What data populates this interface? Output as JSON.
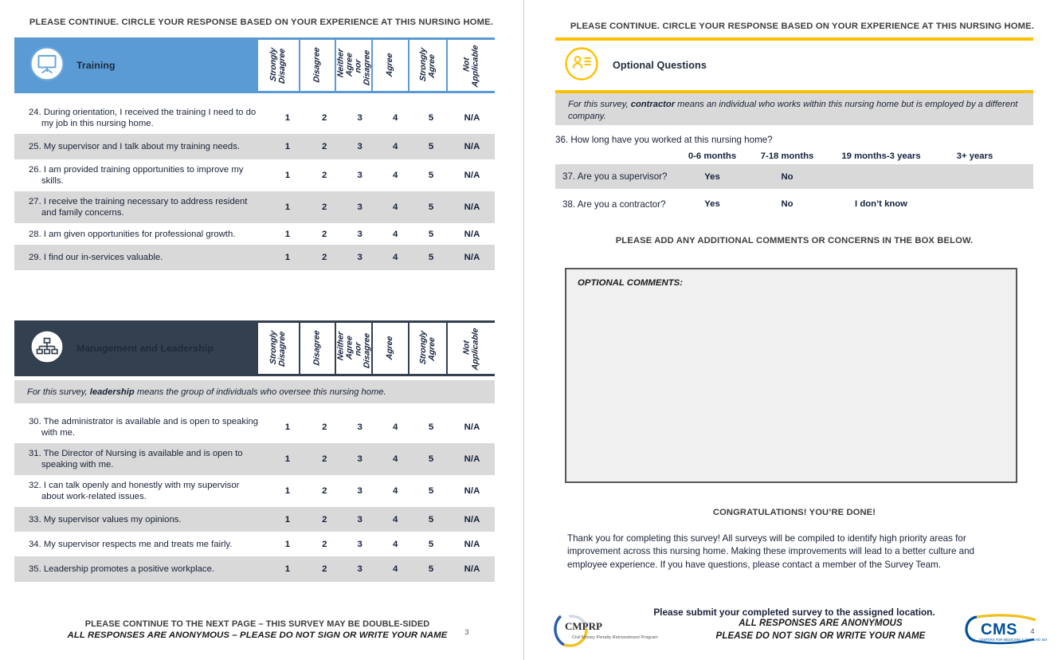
{
  "colors": {
    "training_blue": "#5b9bd5",
    "management_navy": "#33404f",
    "optional_yellow": "#ffc000",
    "row_shade": "#d9d9d9",
    "cms_blue": "#00529b",
    "cms_yellow": "#f2c01e"
  },
  "scale_labels": [
    "Strongly\nDisagree",
    "Disagree",
    "Neither\nAgree nor\nDisagree",
    "Agree",
    "Strongly\nAgree",
    "Not\nApplicable"
  ],
  "scale_values": [
    "1",
    "2",
    "3",
    "4",
    "5",
    "N/A"
  ],
  "left_page": {
    "banner": "PLEASE CONTINUE. CIRCLE YOUR RESPONSE BASED ON YOUR EXPERIENCE AT THIS NURSING HOME.",
    "sections": [
      {
        "title": "Training",
        "icon": "whiteboard-icon",
        "accent": "#5b9bd5",
        "note": null,
        "questions": [
          {
            "num": "24.",
            "text": "During orientation, I received the training I need to do my job in this nursing home.",
            "shaded": false
          },
          {
            "num": "25.",
            "text": "My supervisor and I talk about my training needs.",
            "shaded": true
          },
          {
            "num": "26.",
            "text": "I am provided training opportunities to improve my skills.",
            "shaded": false
          },
          {
            "num": "27.",
            "text": "I receive the training necessary to address resident and family concerns.",
            "shaded": true
          },
          {
            "num": "28.",
            "text": "I am given opportunities for professional growth.",
            "shaded": false
          },
          {
            "num": "29.",
            "text": "I find our in-services valuable.",
            "shaded": true
          }
        ]
      },
      {
        "title": "Management and Leadership",
        "icon": "org-chart-icon",
        "accent": "#33404f",
        "note_prefix": "For this survey, ",
        "note_bold": "leadership",
        "note_suffix": " means the group of individuals who oversee this nursing home.",
        "questions": [
          {
            "num": "30.",
            "text": "The administrator is available and is open to speaking with me.",
            "shaded": false
          },
          {
            "num": "31.",
            "text": "The Director of Nursing is available and is open to speaking with me.",
            "shaded": true
          },
          {
            "num": "32.",
            "text": "I can talk openly and honestly with my supervisor about work-related issues.",
            "shaded": false
          },
          {
            "num": "33.",
            "text": "My supervisor values my opinions.",
            "shaded": true
          },
          {
            "num": "34.",
            "text": "My supervisor respects me and treats me fairly.",
            "shaded": false
          },
          {
            "num": "35.",
            "text": "Leadership promotes a positive workplace.",
            "shaded": true
          }
        ]
      }
    ],
    "footer": {
      "line1": "PLEASE CONTINUE TO THE NEXT PAGE – THIS SURVEY MAY BE DOUBLE-SIDED",
      "line2": "ALL RESPONSES ARE ANONYMOUS – PLEASE DO NOT SIGN OR WRITE YOUR NAME",
      "page_number": "3"
    }
  },
  "right_page": {
    "banner": "PLEASE CONTINUE. CIRCLE YOUR RESPONSE BASED ON YOUR EXPERIENCE AT THIS NURSING HOME.",
    "section": {
      "title": "Optional Questions",
      "icon": "person-list-icon",
      "accent": "#ffc000",
      "note_prefix": "For this survey, ",
      "note_bold": "contractor",
      "note_suffix": " means an individual who works within this nursing home but is employed by a different company."
    },
    "questions": [
      {
        "num": "36.",
        "text": "How long have you worked at this nursing home?",
        "shaded": false,
        "choices": [
          "0-6 months",
          "7-18 months",
          "19 months-3 years",
          "3+ years"
        ],
        "choices_below": true
      },
      {
        "num": "37.",
        "text": "Are you a supervisor?",
        "shaded": true,
        "choices": [
          "Yes",
          "No"
        ],
        "choices_below": false
      },
      {
        "num": "38.",
        "text": "Are you a contractor?",
        "shaded": false,
        "choices": [
          "Yes",
          "No",
          "I don’t know"
        ],
        "choices_below": false
      }
    ],
    "comments_heading": "PLEASE ADD ANY ADDITIONAL COMMENTS OR CONCERNS IN THE BOX BELOW.",
    "comments_label": "OPTIONAL COMMENTS:",
    "comments_value": "",
    "congratulations": "CONGRATULATIONS! YOU’RE DONE!",
    "thank_you": "Thank you for completing this survey! All surveys will be compiled to identify high priority areas for improvement across this nursing home. Making these improvements will lead to a better culture and employee experience. If you have questions, please contact a member of the Survey Team.",
    "submit_line": "Please submit your completed survey to the assigned location.",
    "footer": {
      "cmprp_logo_text": "CMPRP",
      "cmprp_logo_sub": "Civil Money Penalty Reinvestment Program",
      "anon_line1": "ALL RESPONSES ARE ANONYMOUS",
      "anon_line2": "PLEASE DO NOT SIGN OR WRITE YOUR NAME",
      "cms_logo_text": "CMS",
      "cms_logo_sub": "CENTERS FOR MEDICARE & MEDICAID SERVICES",
      "page_number": "4"
    }
  }
}
